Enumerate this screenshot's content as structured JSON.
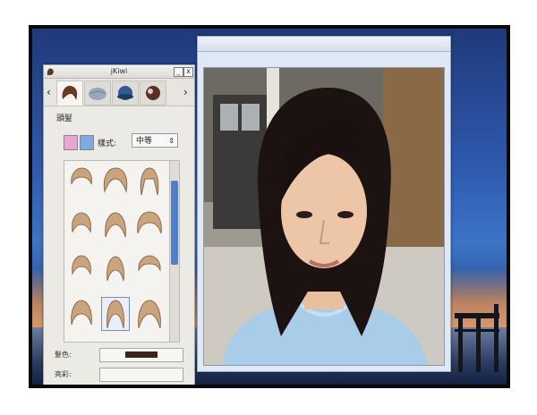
{
  "desktop": {
    "background": "sunset-sea-wallpaper"
  },
  "kiwi_window": {
    "title": "jKiwi",
    "minimize_label": "_",
    "close_label": "x",
    "nav_prev_label": "‹",
    "nav_next_label": "›",
    "tabs": [
      {
        "name": "hair",
        "icon": "hair-icon",
        "active": true
      },
      {
        "name": "fabric",
        "icon": "fabric-icon",
        "active": false
      },
      {
        "name": "hat",
        "icon": "hat-icon",
        "active": false
      },
      {
        "name": "accessory",
        "icon": "accessory-icon",
        "active": false
      }
    ],
    "section_title": "頭髮",
    "style_label": "樣式:",
    "style_value": "中等",
    "hairstyles_count": 12,
    "selected_hairstyle_index": 10,
    "hair_color_label": "髮色:",
    "hair_color": "#3b2418",
    "brightness_label": "亮彩:",
    "scrollbar_position": 0.2
  },
  "photo_window": {
    "title": "",
    "subject": "girl-with-shoulder-length-dark-hair"
  }
}
